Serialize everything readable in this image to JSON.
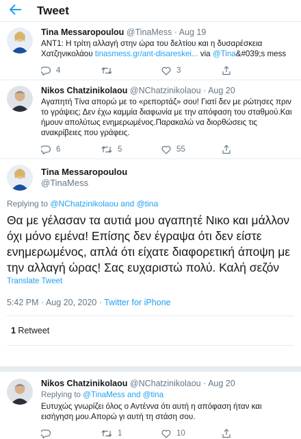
{
  "header": {
    "title": "Tweet"
  },
  "thread": [
    {
      "name": "Tina Messaropoulou",
      "handle": "@TinaMess",
      "dot": "·",
      "date": "Aug 19",
      "text_plain": "ΑΝΤ1: Η τρίτη αλλαγή στην ώρα του δελτίου και η δυσαρέσκεια Χατζηνικολάου ",
      "text_link": "tinasmess.gr/ant-disareskei...",
      "text_via": " via ",
      "text_mention": "@Tina",
      "text_tail": "&#039;s mess",
      "replies": "4",
      "retweets": "",
      "likes": "3"
    },
    {
      "name": "Nikos Chatzinikolaou",
      "handle": "@NChatzinikolaou",
      "dot": "·",
      "date": "Aug 20",
      "text_plain": "Αγαπητή Τίνα απορώ με το «ρεπορτάζ» σου! Γιατί δεν με ρώτησες πριν το γράψεις; Δεν έχω καμμία διαφωνία με την απόφαση του σταθμού.Και ήμουν απολύτως ενημερωμένος.Παρακαλώ να διορθώσεις τις ανακρίβειες που γράφεις.",
      "replies": "6",
      "retweets": "5",
      "likes": "55"
    }
  ],
  "main": {
    "name": "Tina Messaropoulou",
    "handle": "@TinaMess",
    "replying_label": "Replying to ",
    "replying_mentions": "@NChatzinikolaou and @tina",
    "text": "Θα με γέλασαν τα αυτιά μου αγαπητέ Νικο και μάλλον όχι μόνο εμένα! Επίσης δεν έγραψα ότι δεν είστε ενημερωμένος, απλά ότι είχατε διαφορετική άποψη με την αλλαγή ώρας! Σας ευχαριστώ πολύ. Καλή σεζόν",
    "translate": "Translate Tweet",
    "time": "5:42 PM · Aug 20, 2020 · ",
    "source": "Twitter for iPhone",
    "retweet_count": "1",
    "retweet_label": " Retweet"
  },
  "reply": {
    "name": "Nikos Chatzinikolaou",
    "handle": "@NChatzinikolaou",
    "dot": "·",
    "date": "Aug 20",
    "replying_label": "Replying to ",
    "replying_mentions": "@TinaMess and @tina",
    "text": "Ευτυχώς γνωρίζει όλος ο Αντέννα ότι αυτή η απόφαση ήταν και εισήγηση μου.Απορώ γι αυτή τη στάση σου.",
    "replies": "",
    "retweets": "1",
    "likes": "10"
  },
  "colors": {
    "accent": "#1da1f2",
    "muted": "#657786",
    "divider": "#e6ecf0"
  },
  "icons": [
    "back-arrow-icon",
    "reply-icon",
    "retweet-icon",
    "like-icon",
    "share-icon"
  ]
}
